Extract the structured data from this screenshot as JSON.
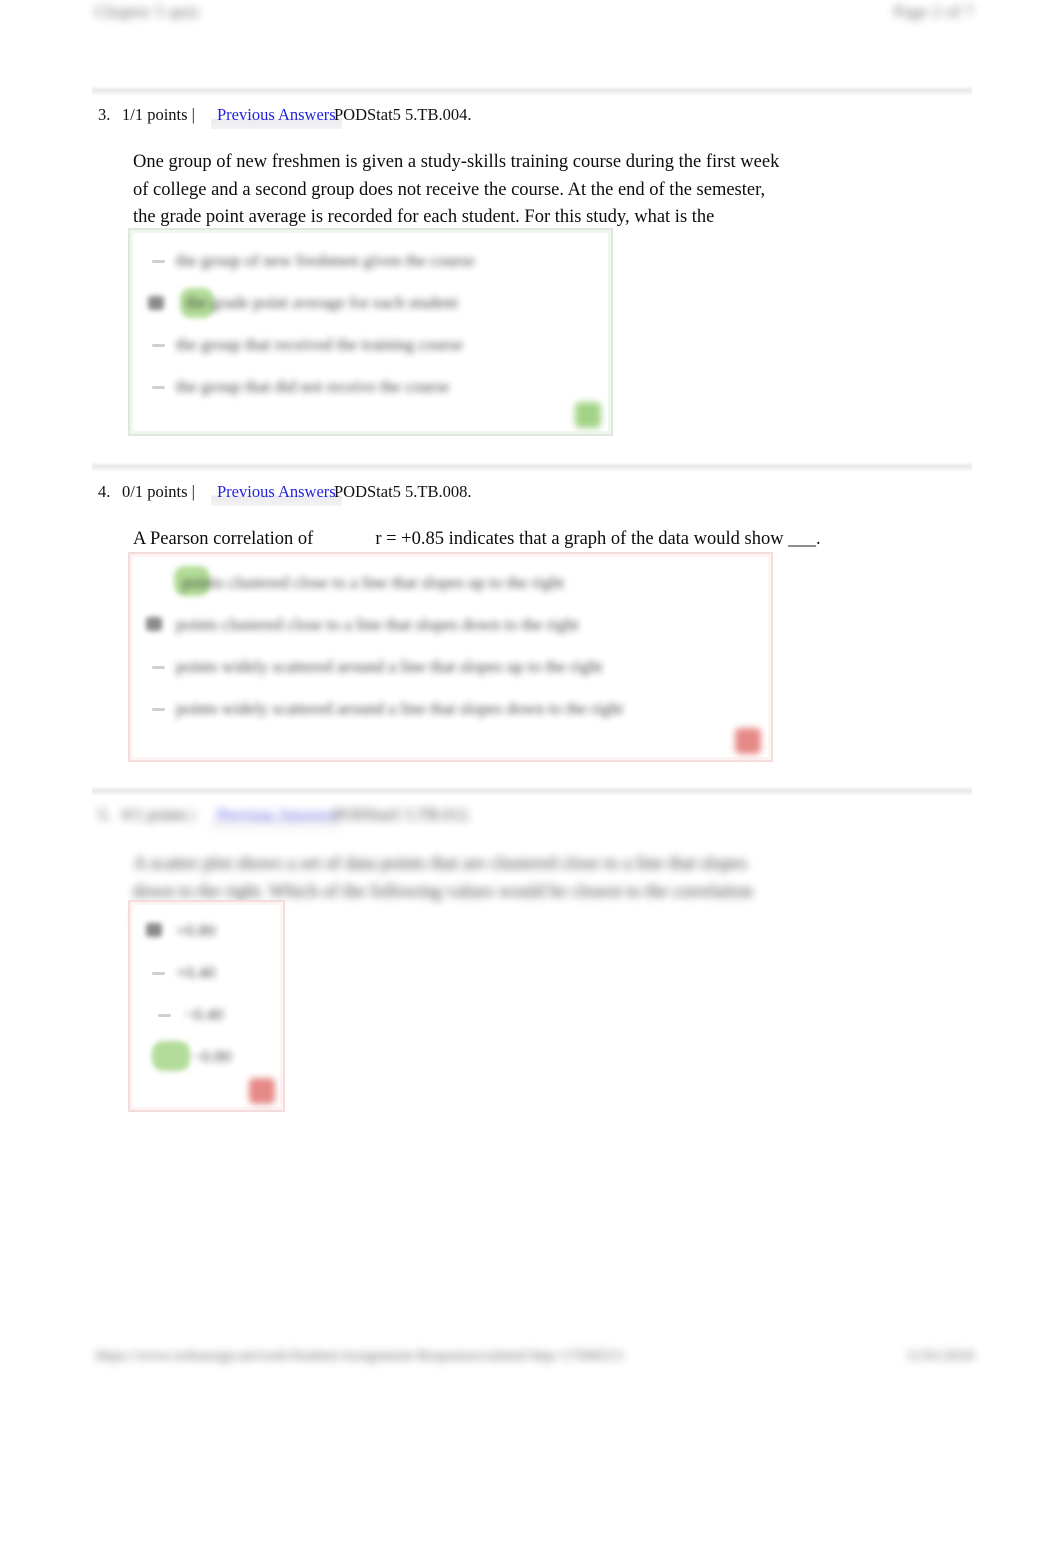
{
  "page": {
    "header_left": "Chapter 5 quiz",
    "header_right": "Page 2 of 7",
    "footer_left": "https://www.webassign.net/web/Student/Assignment-Responses/submit?dep=17008313",
    "footer_right": "11/01/2018"
  },
  "questions": [
    {
      "number": "3.",
      "points": "1/1 points |",
      "previous_answers": "Previous Answers",
      "code": "PODStat5 5.TB.004.",
      "body": "One group of new freshmen is given a study-skills training course during the first week of college and a second group does not receive the course. At the end of the semester, the grade point average is recorded for each student. For this study, what is the dependent variable?",
      "status": "correct",
      "result_icon": "check-icon",
      "options": [
        {
          "text": "the group of new freshmen given the course",
          "selected": false,
          "highlighted": false
        },
        {
          "text": "the grade point average for each student",
          "selected": true,
          "highlighted": true
        },
        {
          "text": "the group that received the training course",
          "selected": false,
          "highlighted": false
        },
        {
          "text": "the group that did not receive the course",
          "selected": false,
          "highlighted": false
        }
      ]
    },
    {
      "number": "4.",
      "points": "0/1 points |",
      "previous_answers": "Previous Answers",
      "code": "PODStat5 5.TB.008.",
      "body_pre": "A Pearson correlation of",
      "body_post": "r  = +0.85 indicates that a graph of the data would show ___.",
      "status": "wrong",
      "result_icon": "cross-icon",
      "options": [
        {
          "text": "points clustered close to a line that slopes up to the right",
          "selected": false,
          "highlighted": true
        },
        {
          "text": "points clustered close to a line that slopes down to the right",
          "selected": true,
          "highlighted": false
        },
        {
          "text": "points widely scattered around a line that slopes up to the right",
          "selected": false,
          "highlighted": false
        },
        {
          "text": "points widely scattered around a line that slopes down to the right",
          "selected": false,
          "highlighted": false
        }
      ]
    },
    {
      "number": "5.",
      "points": "0/1 points |",
      "previous_answers": "Previous Answers",
      "code": "PODStat5 5.TB.012.",
      "body": "A scatter plot shows a set of data points that are clustered close to a line that slopes down to the right. Which of the following values would be closest to the correlation for these data?",
      "status": "wrong",
      "result_icon": "cross-icon",
      "options": [
        {
          "text": "+0.80",
          "selected": true,
          "highlighted": false
        },
        {
          "text": "+0.40",
          "selected": false,
          "highlighted": false
        },
        {
          "text": "−0.40",
          "selected": false,
          "highlighted": false
        },
        {
          "text": "−0.80",
          "selected": false,
          "highlighted": true
        }
      ]
    }
  ],
  "colors": {
    "link": "#2222dd",
    "correct_border": "#dde9da",
    "wrong_border": "#f3dcdb",
    "highlight_green": "#9fd37e",
    "check_green": "#8fca6c",
    "cross_red": "#e0706c"
  }
}
